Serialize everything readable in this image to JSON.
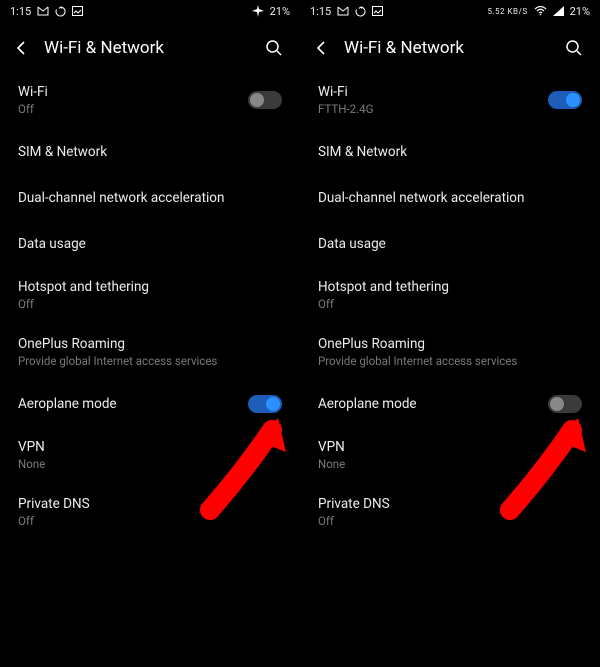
{
  "screens": [
    {
      "status": {
        "time": "1:15",
        "icons_left": [
          "gmail-icon",
          "sync-icon",
          "image-icon"
        ],
        "right": {
          "airplane": true,
          "battery": "21%",
          "extras": []
        }
      },
      "header": {
        "title": "Wi-Fi & Network"
      },
      "rows": [
        {
          "label": "Wi-Fi",
          "sub": "Off",
          "toggle": false
        },
        {
          "label": "SIM & Network"
        },
        {
          "label": "Dual-channel network acceleration"
        },
        {
          "label": "Data usage"
        },
        {
          "label": "Hotspot and tethering",
          "sub": "Off"
        },
        {
          "label": "OnePlus Roaming",
          "sub": "Provide global Internet access services"
        },
        {
          "label": "Aeroplane mode",
          "toggle": true
        },
        {
          "label": "VPN",
          "sub": "None"
        },
        {
          "label": "Private DNS",
          "sub": "Off"
        }
      ]
    },
    {
      "status": {
        "time": "1:15",
        "icons_left": [
          "gmail-icon",
          "sync-icon",
          "image-icon"
        ],
        "right": {
          "airplane": false,
          "battery": "21%",
          "speed": "5.52 KB/S",
          "wifi": true,
          "signal": true
        }
      },
      "header": {
        "title": "Wi-Fi & Network"
      },
      "rows": [
        {
          "label": "Wi-Fi",
          "sub": "FTTH-2.4G",
          "toggle": true
        },
        {
          "label": "SIM & Network"
        },
        {
          "label": "Dual-channel network acceleration"
        },
        {
          "label": "Data usage"
        },
        {
          "label": "Hotspot and tethering",
          "sub": "Off"
        },
        {
          "label": "OnePlus Roaming",
          "sub": "Provide global Internet access services"
        },
        {
          "label": "Aeroplane mode",
          "toggle": false
        },
        {
          "label": "VPN",
          "sub": "None"
        },
        {
          "label": "Private DNS",
          "sub": "Off"
        }
      ]
    }
  ]
}
